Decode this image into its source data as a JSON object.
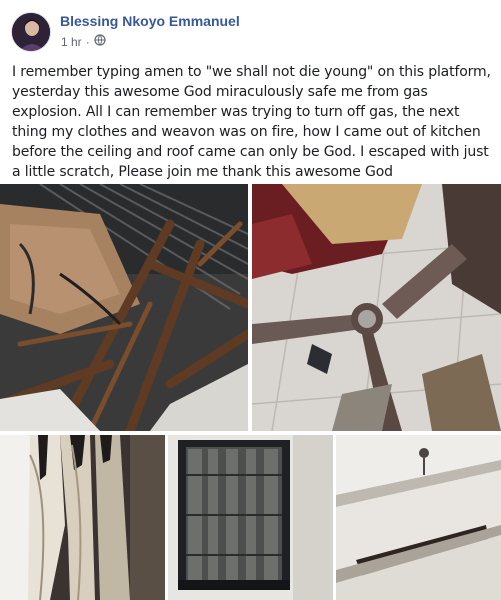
{
  "post": {
    "author": "Blessing Nkoyo Emmanuel",
    "time": "1 hr",
    "body": "I remember typing amen to \"we shall not die young\" on this platform, yesterday this awesome God miraculously safe me from gas explosion. All I can remember was trying to turn off gas, the next thing my clothes and weavon was on fire, how I came out of kitchen before the ceiling and roof came can only be God. I escaped with just a little scratch, Please join me thank this awesome God"
  },
  "icons": {
    "audience": "globe-icon"
  },
  "colors": {
    "author_link": "#385898",
    "meta_text": "#606770",
    "body_text": "#1c1e21"
  }
}
